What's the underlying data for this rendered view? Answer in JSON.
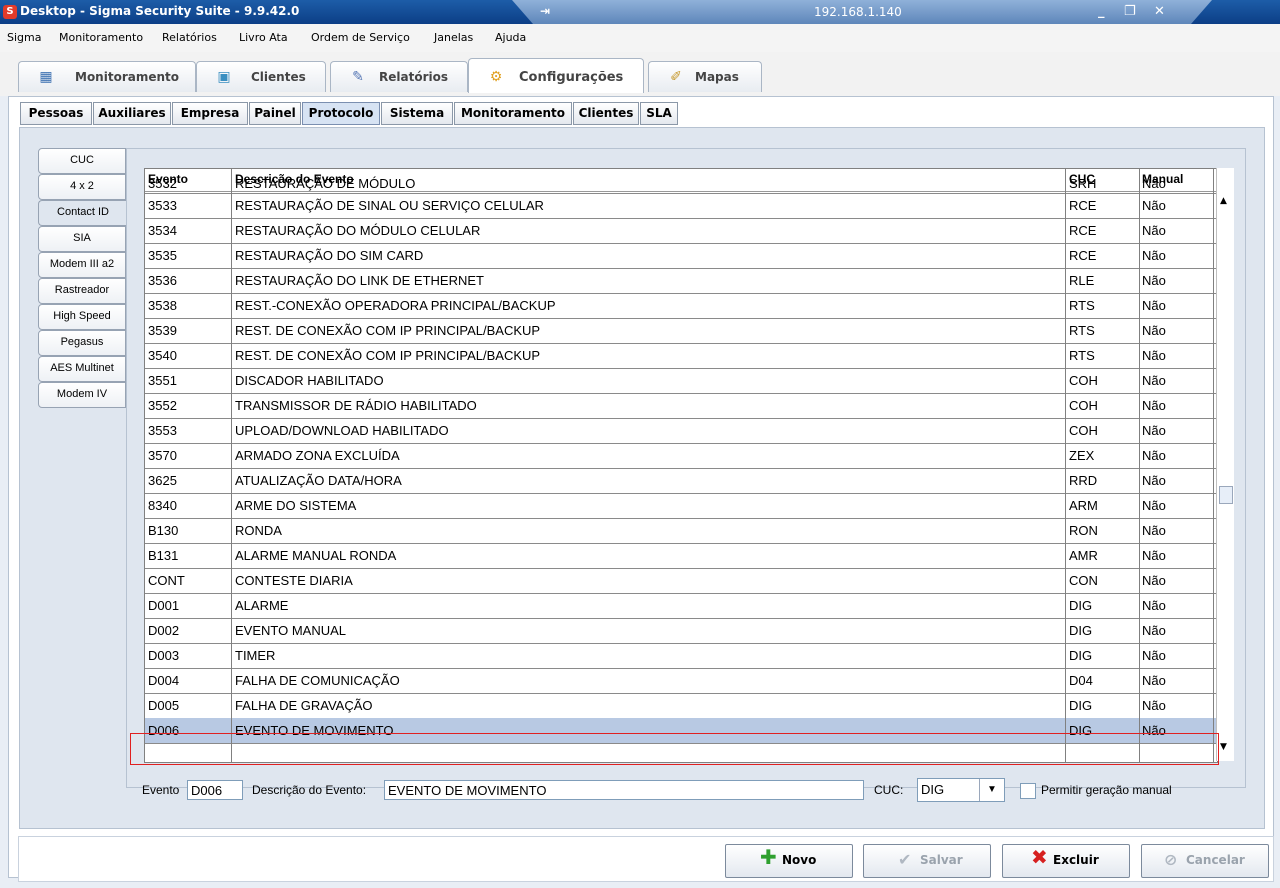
{
  "window": {
    "title": "Desktop - Sigma Security Suite - 9.9.42.0",
    "remote_ip": "192.168.1.140",
    "pin_icon": "pin-icon"
  },
  "menu": [
    "Sigma",
    "Monitoramento",
    "Relatórios",
    "Livro Ata",
    "Ordem de Serviço",
    "Janelas",
    "Ajuda"
  ],
  "main_tabs": [
    {
      "label": "Monitoramento",
      "icon": "monitoring-icon"
    },
    {
      "label": "Clientes",
      "icon": "clients-icon"
    },
    {
      "label": "Relatórios",
      "icon": "reports-icon"
    },
    {
      "label": "Configurações",
      "icon": "gear-icon"
    },
    {
      "label": "Mapas",
      "icon": "map-icon"
    }
  ],
  "sub_tabs": [
    "Pessoas",
    "Auxiliares",
    "Empresa",
    "Painel",
    "Protocolo",
    "Sistema",
    "Monitoramento",
    "Clientes",
    "SLA"
  ],
  "active_sub_tab": "Protocolo",
  "protocol_tabs": [
    "CUC",
    "4 x 2",
    "Contact ID",
    "SIA",
    "Modem III a2",
    "Rastreador",
    "High Speed",
    "Pegasus",
    "AES Multinet",
    "Modem IV"
  ],
  "active_protocol_tab": "Contact ID",
  "grid": {
    "columns": [
      "Evento",
      "Descrição do Evento",
      "CUC",
      "Manual"
    ],
    "rows": [
      [
        "3532",
        "RESTAURAÇÃO DE MÓDULO",
        "SRH",
        "Não"
      ],
      [
        "3533",
        "RESTAURAÇÃO DE SINAL OU SERVIÇO CELULAR",
        "RCE",
        "Não"
      ],
      [
        "3534",
        "RESTAURAÇÃO DO MÓDULO CELULAR",
        "RCE",
        "Não"
      ],
      [
        "3535",
        "RESTAURAÇÃO DO SIM CARD",
        "RCE",
        "Não"
      ],
      [
        "3536",
        "RESTAURAÇÃO DO LINK DE ETHERNET",
        "RLE",
        "Não"
      ],
      [
        "3538",
        "REST.-CONEXÃO OPERADORA PRINCIPAL/BACKUP",
        "RTS",
        "Não"
      ],
      [
        "3539",
        "REST. DE CONEXÃO COM IP PRINCIPAL/BACKUP",
        "RTS",
        "Não"
      ],
      [
        "3540",
        "REST. DE CONEXÃO COM IP PRINCIPAL/BACKUP",
        "RTS",
        "Não"
      ],
      [
        "3551",
        "DISCADOR HABILITADO",
        "COH",
        "Não"
      ],
      [
        "3552",
        "TRANSMISSOR DE RÁDIO HABILITADO",
        "COH",
        "Não"
      ],
      [
        "3553",
        "UPLOAD/DOWNLOAD HABILITADO",
        "COH",
        "Não"
      ],
      [
        "3570",
        "ARMADO ZONA EXCLUÍDA",
        "ZEX",
        "Não"
      ],
      [
        "3625",
        "ATUALIZAÇÃO DATA/HORA",
        "RRD",
        "Não"
      ],
      [
        "8340",
        "ARME DO SISTEMA",
        "ARM",
        "Não"
      ],
      [
        "B130",
        "RONDA",
        "RON",
        "Não"
      ],
      [
        "B131",
        "ALARME MANUAL RONDA",
        "AMR",
        "Não"
      ],
      [
        "CONT",
        "CONTESTE DIARIA",
        "CON",
        "Não"
      ],
      [
        "D001",
        "ALARME",
        "DIG",
        "Não"
      ],
      [
        "D002",
        "EVENTO MANUAL",
        "DIG",
        "Não"
      ],
      [
        "D003",
        "TIMER",
        "DIG",
        "Não"
      ],
      [
        "D004",
        "FALHA DE COMUNICAÇÃO",
        "D04",
        "Não"
      ],
      [
        "D005",
        "FALHA DE GRAVAÇÃO",
        "DIG",
        "Não"
      ],
      [
        "D006",
        "EVENTO DE MOVIMENTO",
        "DIG",
        "Não"
      ]
    ],
    "selected_index": 22
  },
  "form": {
    "evento_label": "Evento",
    "evento_value": "D006",
    "descricao_label": "Descrição do Evento:",
    "descricao_value": "EVENTO DE MOVIMENTO",
    "cuc_label": "CUC:",
    "cuc_value": "DIG",
    "manual_label": "Permitir geração manual"
  },
  "buttons": {
    "novo": "Novo",
    "salvar": "Salvar",
    "excluir": "Excluir",
    "cancelar": "Cancelar"
  },
  "colors": {
    "titlebar": "#0c3e86",
    "selection": "#b8c9e3",
    "highlight_border": "#e02020"
  }
}
